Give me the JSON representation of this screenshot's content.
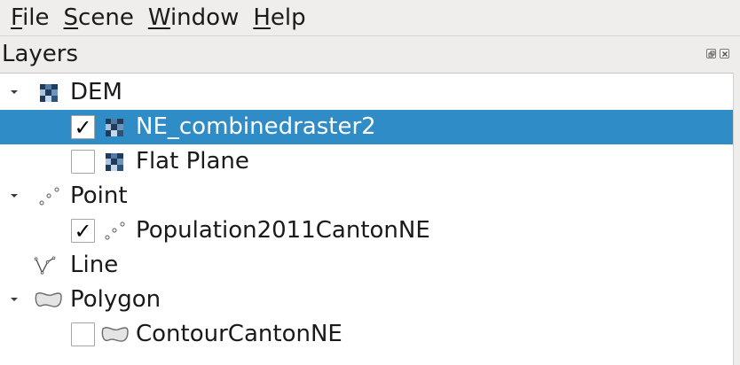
{
  "menubar": {
    "items": [
      {
        "mnemonic": "F",
        "rest": "ile"
      },
      {
        "mnemonic": "S",
        "rest": "cene"
      },
      {
        "mnemonic": "W",
        "rest": "indow"
      },
      {
        "mnemonic": "H",
        "rest": "elp"
      }
    ]
  },
  "dock": {
    "title": "Layers",
    "float_icon": "float-icon",
    "close_icon": "close-icon"
  },
  "tree": {
    "selection_color": "#308cc6",
    "rows": [
      {
        "label": "DEM",
        "type": "group",
        "icon": "raster-icon",
        "expanded": true
      },
      {
        "label": "NE_combinedraster2",
        "type": "layer",
        "icon": "raster-icon",
        "checked": true,
        "selected": true
      },
      {
        "label": "Flat Plane",
        "type": "layer",
        "icon": "raster-icon",
        "checked": false
      },
      {
        "label": "Point",
        "type": "group",
        "icon": "point-icon",
        "expanded": true
      },
      {
        "label": "Population2011CantonNE",
        "type": "layer",
        "icon": "point-icon",
        "checked": true
      },
      {
        "label": "Line",
        "type": "group",
        "icon": "line-icon",
        "expanded": false
      },
      {
        "label": "Polygon",
        "type": "group",
        "icon": "polygon-icon",
        "expanded": true
      },
      {
        "label": "ContourCantonNE",
        "type": "layer",
        "icon": "polygon-icon",
        "checked": false
      }
    ],
    "check_mark": "✓"
  }
}
